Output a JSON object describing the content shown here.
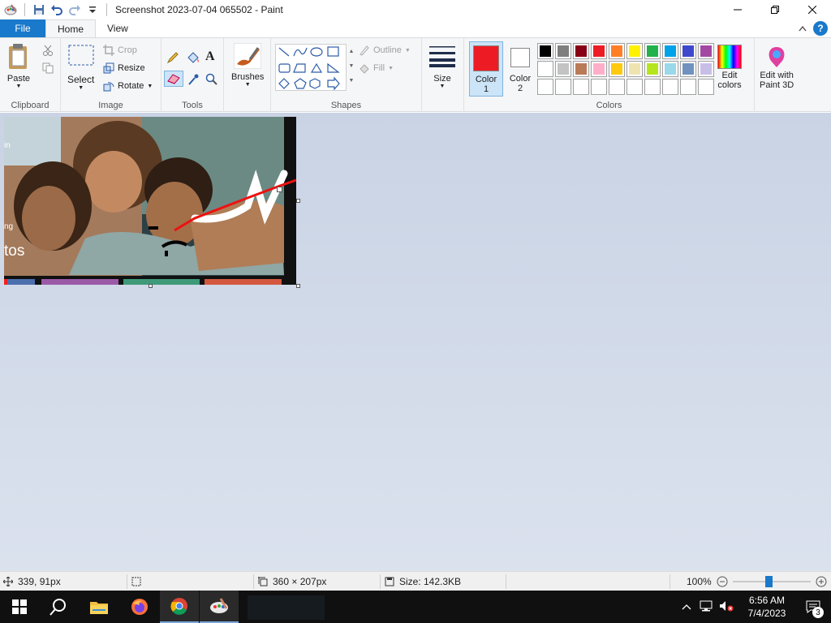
{
  "window": {
    "title": "Screenshot 2023-07-04 065502 - Paint",
    "minimize_icon": "minimize-icon",
    "maximize_icon": "restore-icon",
    "close_icon": "close-icon"
  },
  "tabs": {
    "file": "File",
    "home": "Home",
    "view": "View"
  },
  "ribbon": {
    "clipboard": {
      "label": "Clipboard",
      "paste": "Paste"
    },
    "image": {
      "label": "Image",
      "select": "Select",
      "crop": "Crop",
      "resize": "Resize",
      "rotate": "Rotate"
    },
    "tools": {
      "label": "Tools"
    },
    "brushes": {
      "label": "Brushes"
    },
    "shapes": {
      "label": "Shapes",
      "outline": "Outline",
      "fill": "Fill"
    },
    "size": {
      "label": "Size"
    },
    "colors": {
      "label": "Colors",
      "color1": "Color",
      "color1_num": "1",
      "color2": "Color",
      "color2_num": "2",
      "edit_colors": "Edit",
      "edit_colors2": "colors",
      "color1_value": "#ed1c24",
      "color2_value": "#ffffff",
      "palette": [
        "#000000",
        "#7f7f7f",
        "#880015",
        "#ed1c24",
        "#ff7f27",
        "#fff200",
        "#22b14c",
        "#00a2e8",
        "#3f48cc",
        "#a349a4",
        "#ffffff",
        "#c3c3c3",
        "#b97a57",
        "#ffaec9",
        "#ffc90e",
        "#efe4b0",
        "#b5e61d",
        "#99d9ea",
        "#7092be",
        "#c8bfe7",
        "#ffffff",
        "#ffffff",
        "#ffffff",
        "#ffffff",
        "#ffffff",
        "#ffffff",
        "#ffffff",
        "#ffffff",
        "#ffffff",
        "#ffffff"
      ]
    },
    "paint3d": {
      "line1": "Edit with",
      "line2": "Paint 3D"
    }
  },
  "canvas_text": {
    "fragment1": "tos",
    "fragment2": "in",
    "fragment3": "ng"
  },
  "status": {
    "cursor": "339, 91px",
    "dimensions": "360 × 207px",
    "size": "Size: 142.3KB",
    "zoom": "100%"
  },
  "taskbar": {
    "time": "6:56 AM",
    "date": "7/4/2023",
    "notifications": "3"
  }
}
